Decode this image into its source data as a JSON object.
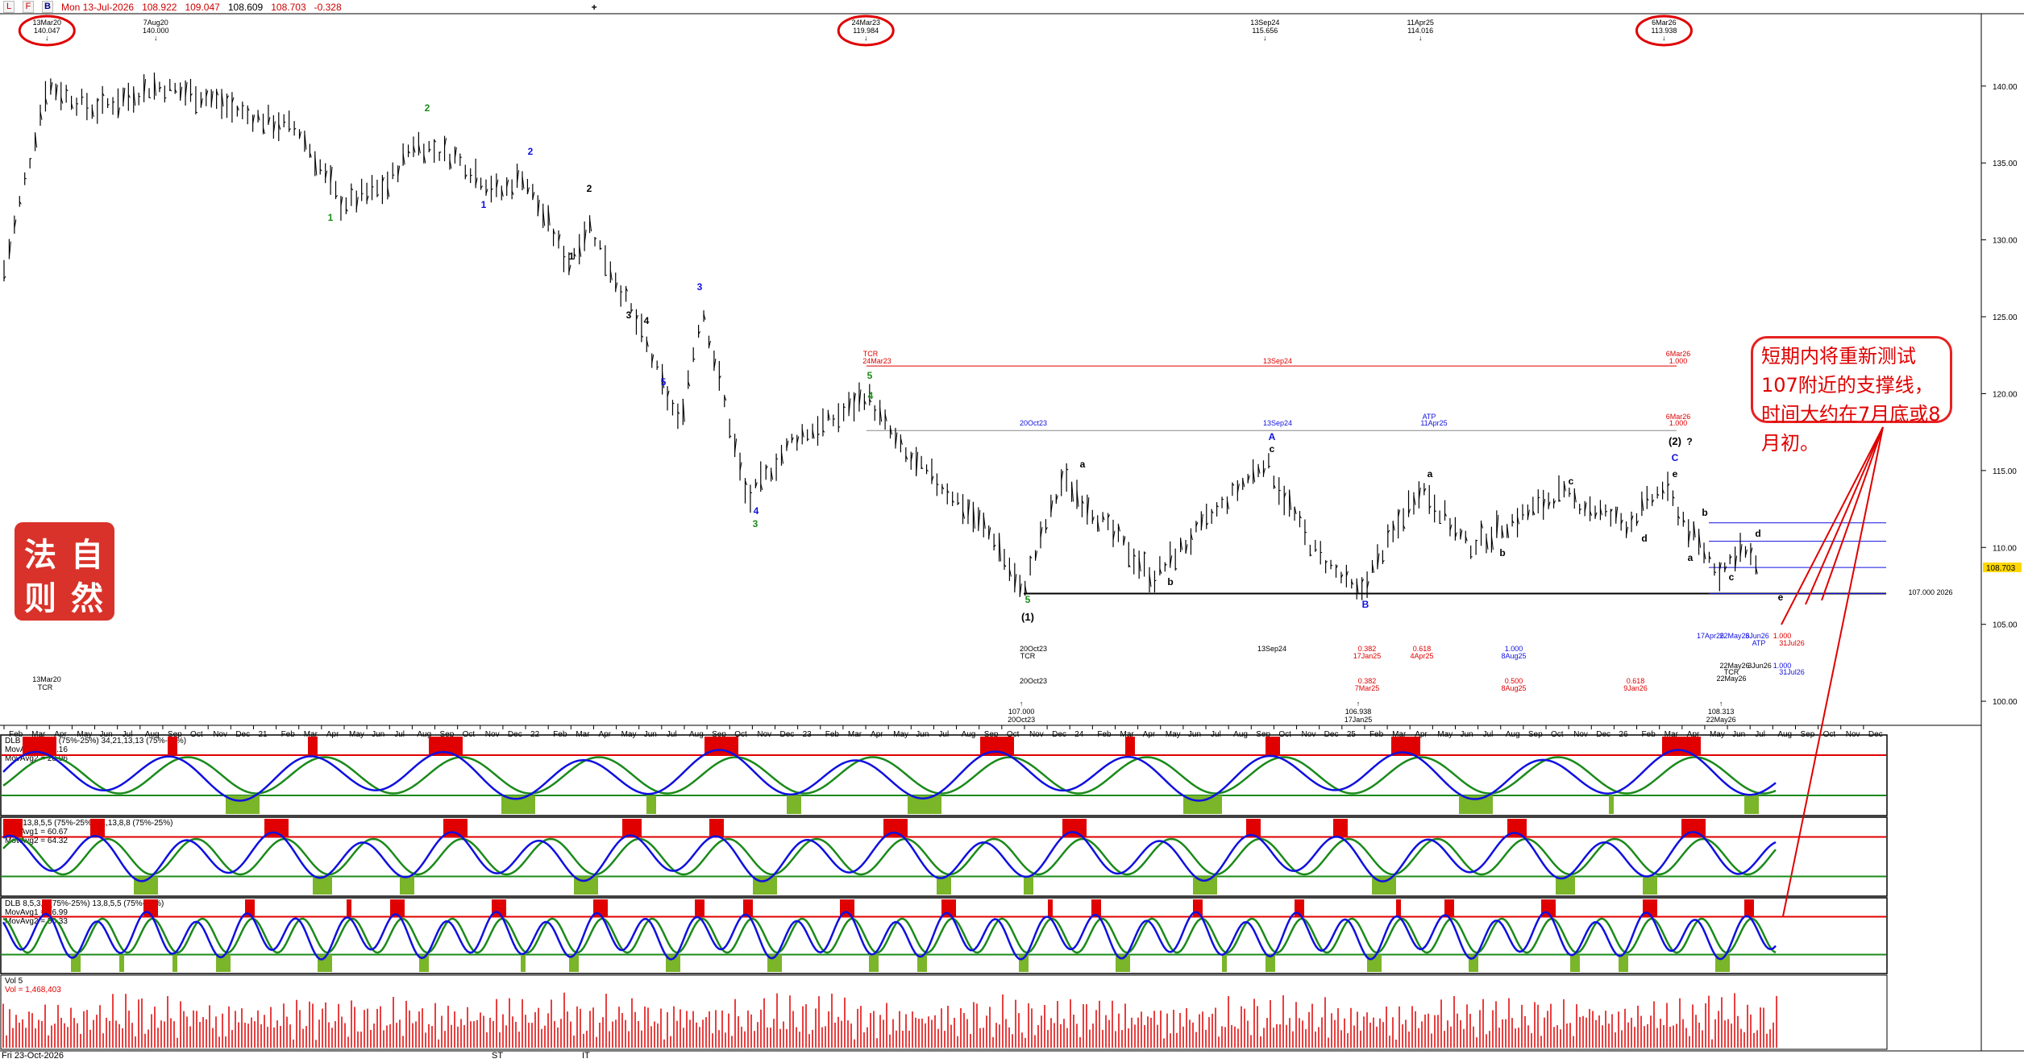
{
  "header": {
    "buttons": [
      "L",
      "F",
      "B"
    ],
    "date": "Mon 13-Jul-2026",
    "open": "108.922",
    "high": "109.047",
    "low": "108.609",
    "close": "108.703",
    "change": "-0.328",
    "add_icon": "plus-icon"
  },
  "annotation_text": "短期内将重新测试107附近的支撑线，时间大约在7月底或8月初。",
  "seal_chars": [
    "自",
    "然",
    "法",
    "则"
  ],
  "top_markers": [
    {
      "date": "13Mar20",
      "value": "140.047",
      "circled": true
    },
    {
      "date": "7Aug20",
      "value": "140.000",
      "circled": false
    },
    {
      "date": "24Mar23",
      "value": "119.984",
      "circled": true
    },
    {
      "date": "13Sep24",
      "value": "115.656",
      "circled": false
    },
    {
      "date": "11Apr25",
      "value": "114.016",
      "circled": false
    },
    {
      "date": "6Mar26",
      "value": "113.938",
      "circled": true
    }
  ],
  "bottom_markers": [
    {
      "value": "107.000",
      "date": "20Oct23"
    },
    {
      "value": "106.938",
      "date": "17Jan25"
    },
    {
      "value": "108.313",
      "date": "22May26"
    }
  ],
  "fib_labels": [
    "0.382",
    "17Jan25",
    "0.618",
    "4Apr25",
    "1.000",
    "8Aug25",
    "0.382",
    "7Mar25",
    "0.500",
    "8Aug25",
    "0.618",
    "9Jan26"
  ],
  "cycle_labels": [
    "20Oct23",
    "TCR",
    "20Oct23",
    "13Sep24",
    "13Mar20",
    "TCR",
    "TCR",
    "24Mar23",
    "13Sep24",
    "6Mar26",
    "1.000",
    "20Oct23",
    "13Sep24",
    "ATP",
    "11Apr25",
    "6Mar26",
    "1.000",
    "17Apr26",
    "22May26",
    "3Jun26",
    "1.000",
    "31Jul26",
    "22May26",
    "3Jun26",
    "1.000",
    "31Jul26",
    "ATP",
    "TCR",
    "22May26",
    "107.000 2026"
  ],
  "wave_labels": [
    "1",
    "2",
    "1",
    "2",
    "1",
    "2",
    "3",
    "4",
    "5",
    "3",
    "4",
    "5",
    "3",
    "4",
    "5",
    "(1)",
    "a",
    "b",
    "A",
    "c",
    "B",
    "a",
    "b",
    "c",
    "d",
    "e",
    "C",
    "(2)",
    "?",
    "a",
    "b",
    "c",
    "d",
    "e"
  ],
  "x_months": [
    "Feb",
    "Mar",
    "Apr",
    "May",
    "Jun",
    "Jul",
    "Aug",
    "Sep",
    "Oct",
    "Nov",
    "Dec",
    "21",
    "Feb",
    "Mar",
    "Apr",
    "May",
    "Jun",
    "Jul",
    "Aug",
    "Sep",
    "Oct",
    "Nov",
    "Dec",
    "22",
    "Feb",
    "Mar",
    "Apr",
    "May",
    "Jun",
    "Jul",
    "Aug",
    "Sep",
    "Oct",
    "Nov",
    "Dec",
    "23",
    "Feb",
    "Mar",
    "Apr",
    "May",
    "Jun",
    "Jul",
    "Aug",
    "Sep",
    "Oct",
    "Nov",
    "Dec",
    "24",
    "Feb",
    "Mar",
    "Apr",
    "May",
    "Jun",
    "Jul",
    "Aug",
    "Sep",
    "Oct",
    "Nov",
    "Dec",
    "25",
    "Feb",
    "Mar",
    "Apr",
    "May",
    "Jun",
    "Jul",
    "Aug",
    "Sep",
    "Oct",
    "Nov",
    "Dec",
    "26",
    "Feb",
    "Mar",
    "Apr",
    "May",
    "Jun",
    "Jul",
    "Aug",
    "Sep",
    "Oct",
    "Nov",
    "Dec"
  ],
  "y_ticks": [
    "140.00",
    "135.00",
    "130.00",
    "125.00",
    "120.00",
    "115.00",
    "110.00",
    "105.00",
    "100.00"
  ],
  "last_price": "108.703",
  "panels": [
    {
      "title": "DLB 21,13,8,8 (75%-25%) 34,21,13,13 (75%-25%)",
      "ma1": "MovAvg1 = 40.16",
      "ma2": "MovAvg2 = 28.96"
    },
    {
      "title": "DLB 13,8,5,5 (75%-25%) 21,13,8,8 (75%-25%)",
      "ma1": "MovAvg1 = 60.67",
      "ma2": "MovAvg2 = 64.32"
    },
    {
      "title": "DLB 8,5,3,3 (75%-25%) 13,8,5,5 (75%-25%)",
      "ma1": "MovAvg1 = 16.99",
      "ma2": "MovAvg2 = 50.33"
    }
  ],
  "volume": {
    "title": "Vol 5",
    "value": "Vol = 1,468,403"
  },
  "footer": {
    "date": "Fri 23-Oct-2026",
    "label_st": "ST",
    "label_it": "IT"
  },
  "colors": {
    "up": "#000000",
    "blue": "#1010e0",
    "green": "#1a8a1a",
    "red": "#e00000",
    "zone_red": "#e00000",
    "zone_green": "#7ab52a",
    "last_price_bg": "#ffd700"
  },
  "chart_data": {
    "type": "bar",
    "title": "",
    "xlabel": "",
    "ylabel": "",
    "x_range": [
      "2020-01",
      "2026-12"
    ],
    "ylim": [
      98.8,
      143.5
    ],
    "grid": false,
    "price_path": [
      {
        "date": "2020-01",
        "value": 128
      },
      {
        "date": "2020-03-13",
        "value": 140.047
      },
      {
        "date": "2020-05",
        "value": 138.5
      },
      {
        "date": "2020-08-07",
        "value": 140.0
      },
      {
        "date": "2020-10",
        "value": 139.3
      },
      {
        "date": "2020-12",
        "value": 138.0
      },
      {
        "date": "2021-02",
        "value": 137.2
      },
      {
        "date": "2021-04",
        "value": 132.3
      },
      {
        "date": "2021-06",
        "value": 133.5
      },
      {
        "date": "2021-07-20",
        "value": 136.3
      },
      {
        "date": "2021-09",
        "value": 135.4
      },
      {
        "date": "2021-11",
        "value": 133.0
      },
      {
        "date": "2021-12",
        "value": 134.2
      },
      {
        "date": "2022-02",
        "value": 128.5
      },
      {
        "date": "2022-03",
        "value": 131.0
      },
      {
        "date": "2022-05",
        "value": 125.0
      },
      {
        "date": "2022-07",
        "value": 118.0
      },
      {
        "date": "2022-08",
        "value": 125.6
      },
      {
        "date": "2022-10",
        "value": 113.0
      },
      {
        "date": "2022-12",
        "value": 117.0
      },
      {
        "date": "2023-02",
        "value": 118.5
      },
      {
        "date": "2023-03-24",
        "value": 119.984
      },
      {
        "date": "2023-05",
        "value": 116.0
      },
      {
        "date": "2023-07",
        "value": 113.6
      },
      {
        "date": "2023-09",
        "value": 110.5
      },
      {
        "date": "2023-10-20",
        "value": 107.0
      },
      {
        "date": "2023-12",
        "value": 114.5
      },
      {
        "date": "2024-04",
        "value": 108.0
      },
      {
        "date": "2024-09-13",
        "value": 115.656
      },
      {
        "date": "2024-11",
        "value": 110.0
      },
      {
        "date": "2025-01-17",
        "value": 106.938
      },
      {
        "date": "2025-04-11",
        "value": 114.016
      },
      {
        "date": "2025-06",
        "value": 110.0
      },
      {
        "date": "2025-10",
        "value": 113.5
      },
      {
        "date": "2026-01",
        "value": 111.5
      },
      {
        "date": "2026-03-06",
        "value": 113.938
      },
      {
        "date": "2026-04-17",
        "value": 110.5
      },
      {
        "date": "2026-05-22",
        "value": 108.313
      },
      {
        "date": "2026-06",
        "value": 110.0
      },
      {
        "date": "2026-07-13",
        "value": 108.703
      }
    ],
    "horizontal_lines": [
      {
        "value": 121.8,
        "color": "red"
      },
      {
        "value": 117.6,
        "color": "gray"
      },
      {
        "value": 107.0,
        "color": "black"
      },
      {
        "value": 111.6,
        "color": "blue"
      },
      {
        "value": 110.4,
        "color": "blue"
      },
      {
        "value": 108.7,
        "color": "blue"
      },
      {
        "value": 107.0,
        "color": "blue"
      }
    ]
  }
}
